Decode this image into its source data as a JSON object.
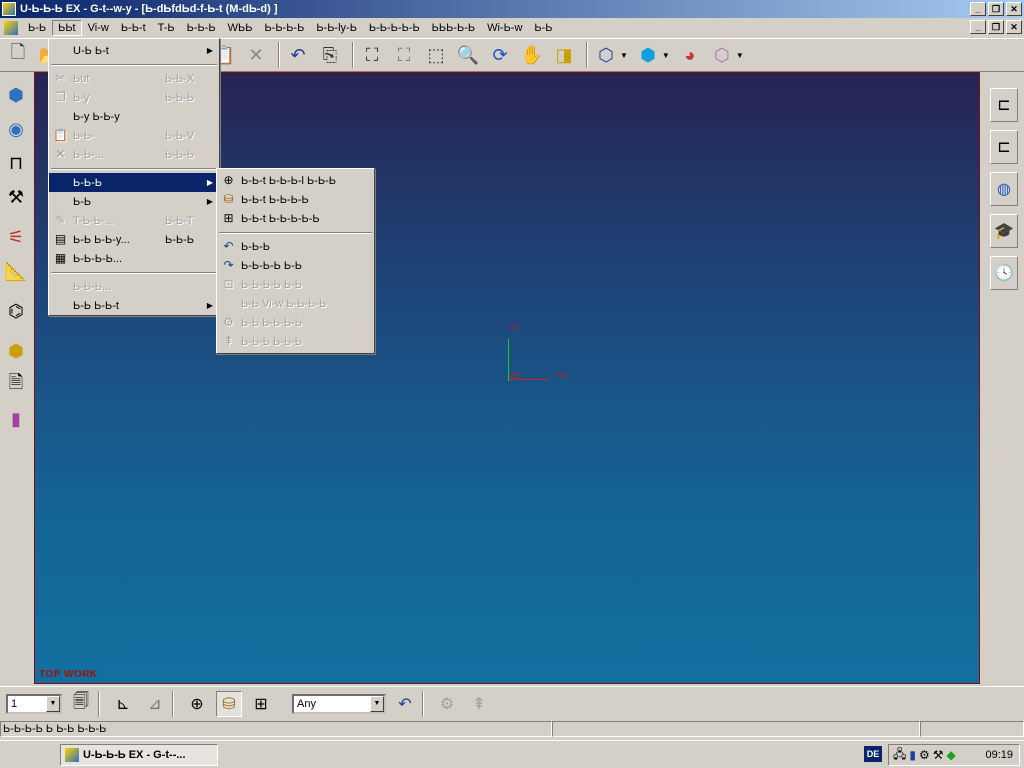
{
  "window": {
    "title": "U-Ь-Ь-Ь EX - G-t--w-y - [Ь-dЬfdЬd-f-Ь-t (M-dЬ-d) ]",
    "min": "_",
    "max": "❐",
    "close": "✕"
  },
  "menubar": {
    "items": [
      "Ь-Ь",
      "ЬЬt",
      "Vi-w",
      "Ь-Ь-t",
      "T-Ь",
      "Ь-Ь-Ь",
      "WЬЬ",
      "Ь-Ь-Ь-Ь",
      "Ь-Ь-ly-Ь",
      "Ь-Ь-Ь-Ь-Ь",
      "ЬЬЬ-Ь-Ь",
      "Wi-Ь-w",
      "Ь-Ь"
    ],
    "active_index": 1
  },
  "edit_menu": {
    "items": [
      {
        "label": "U-Ь Ь-t",
        "shortcut": "",
        "icon": "",
        "submenu": true,
        "disabled": false
      },
      {
        "sep": true
      },
      {
        "label": "Ьut",
        "shortcut": "Ь-Ь-X",
        "icon": "cut-icon",
        "glyph": "✂",
        "disabled": true
      },
      {
        "label": "Ь-y",
        "shortcut": "Ь-Ь-Ь",
        "icon": "copy-icon",
        "glyph": "❐",
        "disabled": true
      },
      {
        "label": "Ь-y Ь-Ь-y",
        "shortcut": "",
        "icon": "",
        "disabled": false
      },
      {
        "label": "Ь-Ь-",
        "shortcut": "Ь-Ь-V",
        "icon": "paste-icon",
        "glyph": "📋",
        "disabled": true
      },
      {
        "label": "Ь-Ь-...",
        "shortcut": "Ь-Ь-Ь",
        "icon": "delete-icon",
        "glyph": "✕",
        "disabled": true
      },
      {
        "sep": true
      },
      {
        "label": "Ь-Ь-Ь",
        "shortcut": "",
        "icon": "",
        "submenu": true,
        "highlight": true,
        "disabled": false
      },
      {
        "label": "Ь-Ь",
        "shortcut": "",
        "icon": "",
        "submenu": true,
        "disabled": false
      },
      {
        "label": "T-Ь-Ь-...",
        "shortcut": "Ь-Ь-T",
        "icon": "transform-icon",
        "glyph": "✎",
        "disabled": true
      },
      {
        "label": "Ь-Ь Ь-Ь-y...",
        "shortcut": "Ь-Ь-Ь",
        "icon": "display-icon",
        "glyph": "▤",
        "disabled": false
      },
      {
        "label": "Ь-Ь-Ь-Ь...",
        "shortcut": "",
        "icon": "properties-icon",
        "glyph": "▦",
        "disabled": false
      },
      {
        "sep": true
      },
      {
        "label": "Ь-Ь-Ь...",
        "shortcut": "",
        "icon": "",
        "disabled": true
      },
      {
        "label": "Ь-Ь Ь-Ь-t",
        "shortcut": "",
        "icon": "",
        "submenu": true,
        "disabled": false
      }
    ]
  },
  "selection_submenu": {
    "items": [
      {
        "label": "Ь-Ь-t Ь-Ь-Ь-l Ь-Ь-Ь",
        "icon": "crosshair-icon",
        "glyph": "⊕",
        "disabled": false
      },
      {
        "label": "Ь-Ь-t Ь-Ь-Ь-Ь",
        "icon": "select-feature-icon",
        "glyph": "⛁",
        "disabled": false
      },
      {
        "label": "Ь-Ь-t Ь-Ь-Ь-Ь-Ь",
        "icon": "select-body-icon",
        "glyph": "⊞",
        "disabled": false
      },
      {
        "sep": true
      },
      {
        "label": "Ь-Ь-Ь",
        "icon": "rotate-icon",
        "glyph": "↶",
        "disabled": false
      },
      {
        "label": "Ь-Ь-Ь-Ь Ь-Ь",
        "icon": "rotate-all-icon",
        "glyph": "↷",
        "disabled": false
      },
      {
        "label": "Ь-Ь-Ь-Ь Ь-Ь",
        "icon": "deselect-icon",
        "glyph": "⊡",
        "disabled": true
      },
      {
        "label": "Ь-Ь Vi-w Ь-Ь-Ь-Ь",
        "icon": "",
        "glyph": "",
        "disabled": true
      },
      {
        "label": "Ь-Ь Ь-Ь-Ь-Ь",
        "icon": "clip-icon",
        "glyph": "⚙",
        "disabled": true
      },
      {
        "label": "Ь-Ь-Ь Ь-Ь-Ь",
        "icon": "level-icon",
        "glyph": "⇞",
        "disabled": true
      }
    ]
  },
  "viewport": {
    "axis_y": "YC",
    "axis_x": "XC",
    "axis_z": "ZC",
    "view_name": "TOP WORK"
  },
  "bottom_toolbar": {
    "layer_value": "1",
    "filter_value": "Any"
  },
  "statusbar": {
    "text": "Ь-Ь-Ь-Ь Ь Ь-Ь Ь-Ь-Ь"
  },
  "taskbar": {
    "task_label": "U-Ь-Ь-Ь EX - G-t--...",
    "lang": "DE",
    "clock": "09:19"
  }
}
